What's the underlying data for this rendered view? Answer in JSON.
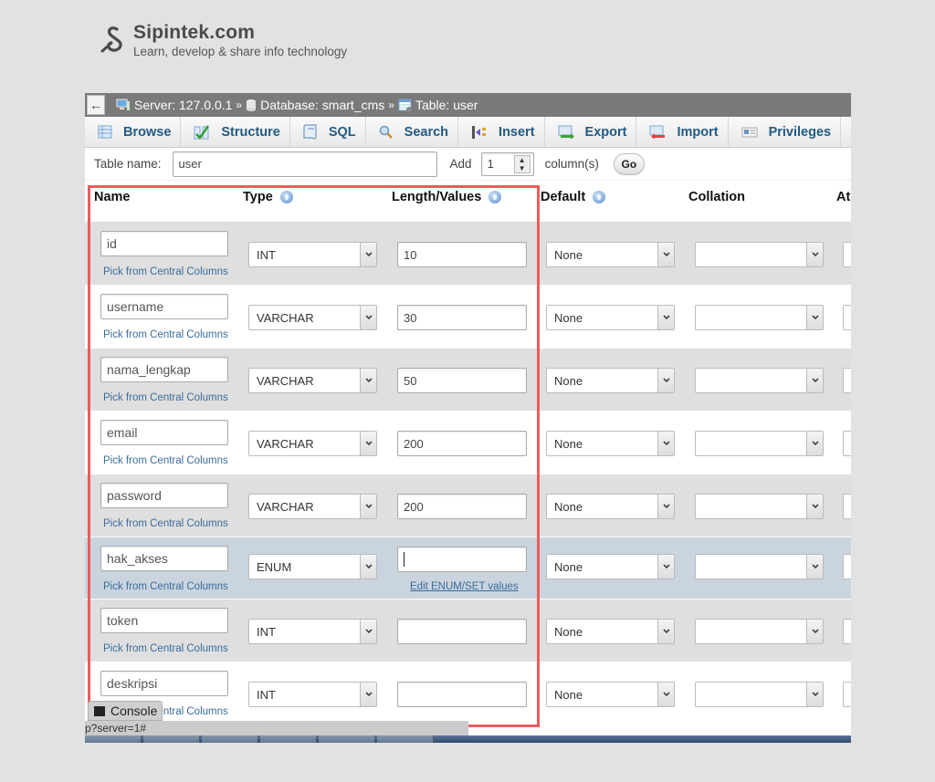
{
  "brand": {
    "name": "Sipintek.com",
    "tagline": "Learn, develop & share info technology"
  },
  "breadcrumb": {
    "back": "←",
    "server": "Server: 127.0.0.1",
    "database": "Database: smart_cms",
    "table": "Table: user",
    "separator": "»"
  },
  "tabs": [
    {
      "label": "Browse",
      "icon": "browse-icon"
    },
    {
      "label": "Structure",
      "icon": "structure-icon"
    },
    {
      "label": "SQL",
      "icon": "sql-icon"
    },
    {
      "label": "Search",
      "icon": "search-icon"
    },
    {
      "label": "Insert",
      "icon": "insert-icon"
    },
    {
      "label": "Export",
      "icon": "export-icon"
    },
    {
      "label": "Import",
      "icon": "import-icon"
    },
    {
      "label": "Privileges",
      "icon": "privileges-icon"
    },
    {
      "label": "",
      "icon": "wrench-icon"
    }
  ],
  "table_name_row": {
    "label": "Table name:",
    "value": "user",
    "add_label": "Add",
    "add_count": "1",
    "columns_label": "column(s)",
    "go_label": "Go"
  },
  "headers": {
    "name": "Name",
    "type": "Type",
    "length": "Length/Values",
    "default": "Default",
    "collation": "Collation",
    "attributes": "At"
  },
  "pick_label": "Pick from Central Columns",
  "enum_link": "Edit ENUM/SET values",
  "rows": [
    {
      "name": "id",
      "type": "INT",
      "length": "10",
      "default": "None",
      "collation": ""
    },
    {
      "name": "username",
      "type": "VARCHAR",
      "length": "30",
      "default": "None",
      "collation": ""
    },
    {
      "name": "nama_lengkap",
      "type": "VARCHAR",
      "length": "50",
      "default": "None",
      "collation": ""
    },
    {
      "name": "email",
      "type": "VARCHAR",
      "length": "200",
      "default": "None",
      "collation": ""
    },
    {
      "name": "password",
      "type": "VARCHAR",
      "length": "200",
      "default": "None",
      "collation": ""
    },
    {
      "name": "hak_akses",
      "type": "ENUM",
      "length": "",
      "default": "None",
      "collation": ""
    },
    {
      "name": "token",
      "type": "INT",
      "length": "",
      "default": "None",
      "collation": ""
    },
    {
      "name": "deskripsi",
      "type": "INT",
      "length": "",
      "default": "None",
      "collation": ""
    }
  ],
  "console_label": "Console",
  "status_url": "p?server=1#",
  "colors": {
    "highlight": "#f05a5a",
    "link": "#3a6c9a",
    "tab_text": "#235a81",
    "marked_row": "#c9d4df"
  }
}
